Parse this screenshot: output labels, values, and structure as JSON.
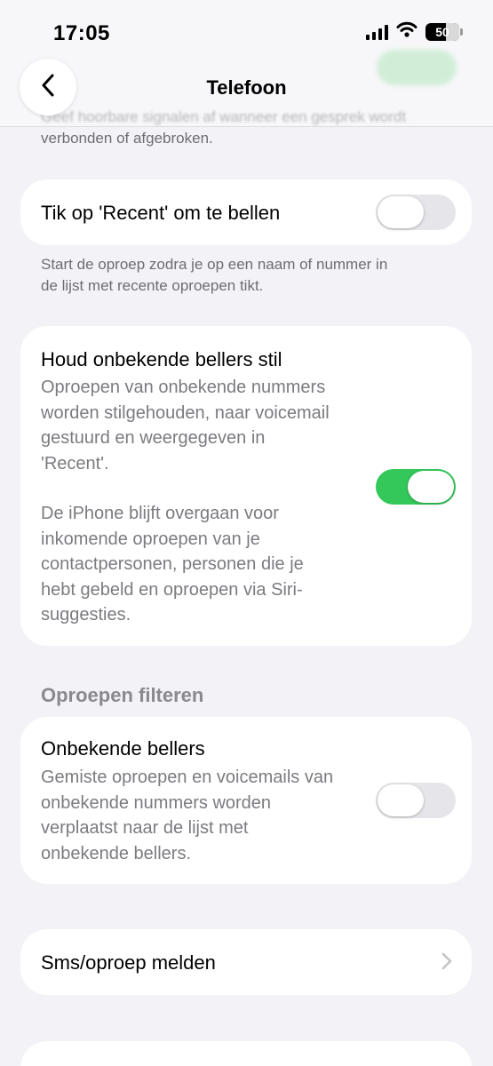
{
  "status_bar": {
    "time": "17:05",
    "battery": "50"
  },
  "nav": {
    "title": "Telefoon"
  },
  "intro_footer": "verbonden of afgebroken.",
  "recent_call": {
    "label": "Tik op 'Recent' om te bellen",
    "toggle_on": false,
    "footer_line1": "Start de oproep zodra je op een naam of nummer in",
    "footer_line2": "de lijst met recente oproepen tikt."
  },
  "silence_unknown": {
    "label": "Houd onbekende bellers stil",
    "toggle_on": true,
    "desc1": [
      "Oproepen van onbekende nummers",
      "worden stilgehouden, naar voicemail",
      "gestuurd en weergegeven in",
      "'Recent'."
    ],
    "desc2": [
      "De iPhone blijft overgaan voor",
      "inkomende oproepen van je",
      "contactpersonen, personen die je",
      "hebt gebeld en oproepen via Siri-",
      "suggesties."
    ]
  },
  "filter_section": {
    "header": "Oproepen filteren"
  },
  "unknown_callers": {
    "label": "Onbekende bellers",
    "toggle_on": false,
    "desc": [
      "Gemiste oproepen en voicemails van",
      "onbekende nummers worden",
      "verplaatst naar de lijst met",
      "onbekende bellers."
    ]
  },
  "report": {
    "label": "Sms/oproep melden"
  },
  "colors": {
    "accent_green": "#34c759",
    "background": "#f2f2f7"
  }
}
